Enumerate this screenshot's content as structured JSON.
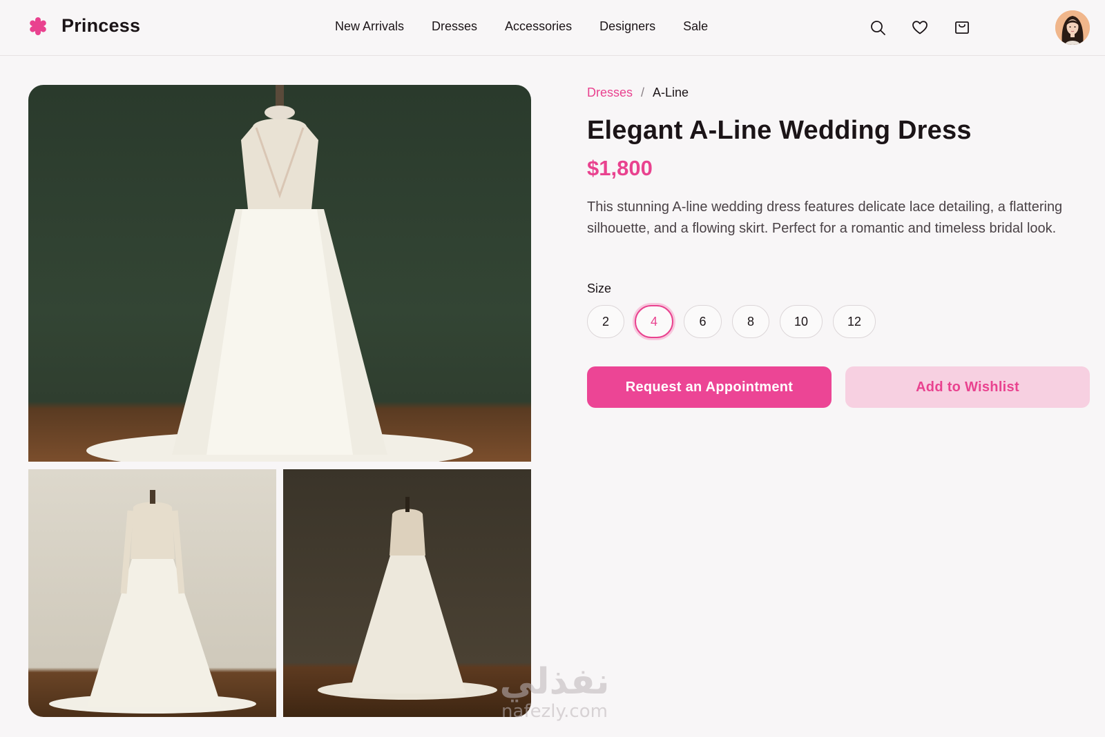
{
  "brand": {
    "name": "Princess",
    "color": "#e9428f"
  },
  "nav": {
    "items": [
      {
        "label": "New Arrivals"
      },
      {
        "label": "Dresses"
      },
      {
        "label": "Accessories"
      },
      {
        "label": "Designers"
      },
      {
        "label": "Sale"
      }
    ]
  },
  "header_icons": [
    "search-icon",
    "heart-icon",
    "cart-icon"
  ],
  "breadcrumb": {
    "parent": "Dresses",
    "separator": "/",
    "current": "A-Line"
  },
  "product": {
    "title": "Elegant A-Line Wedding Dress",
    "price": "$1,800",
    "description": "This stunning A-line wedding dress features delicate lace detailing, a flattering silhouette, and a flowing skirt. Perfect for a romantic and timeless bridal look."
  },
  "size": {
    "label": "Size",
    "options": [
      "2",
      "4",
      "6",
      "8",
      "10",
      "12"
    ],
    "selected": "4"
  },
  "actions": {
    "primary_label": "Request an Appointment",
    "secondary_label": "Add to Wishlist"
  },
  "watermark": {
    "arabic": "نفذلي",
    "latin": "nafezly.com"
  },
  "colors": {
    "accent": "#e9428f",
    "primary_button": "#ec4595",
    "secondary_button": "#f7d0e1"
  }
}
